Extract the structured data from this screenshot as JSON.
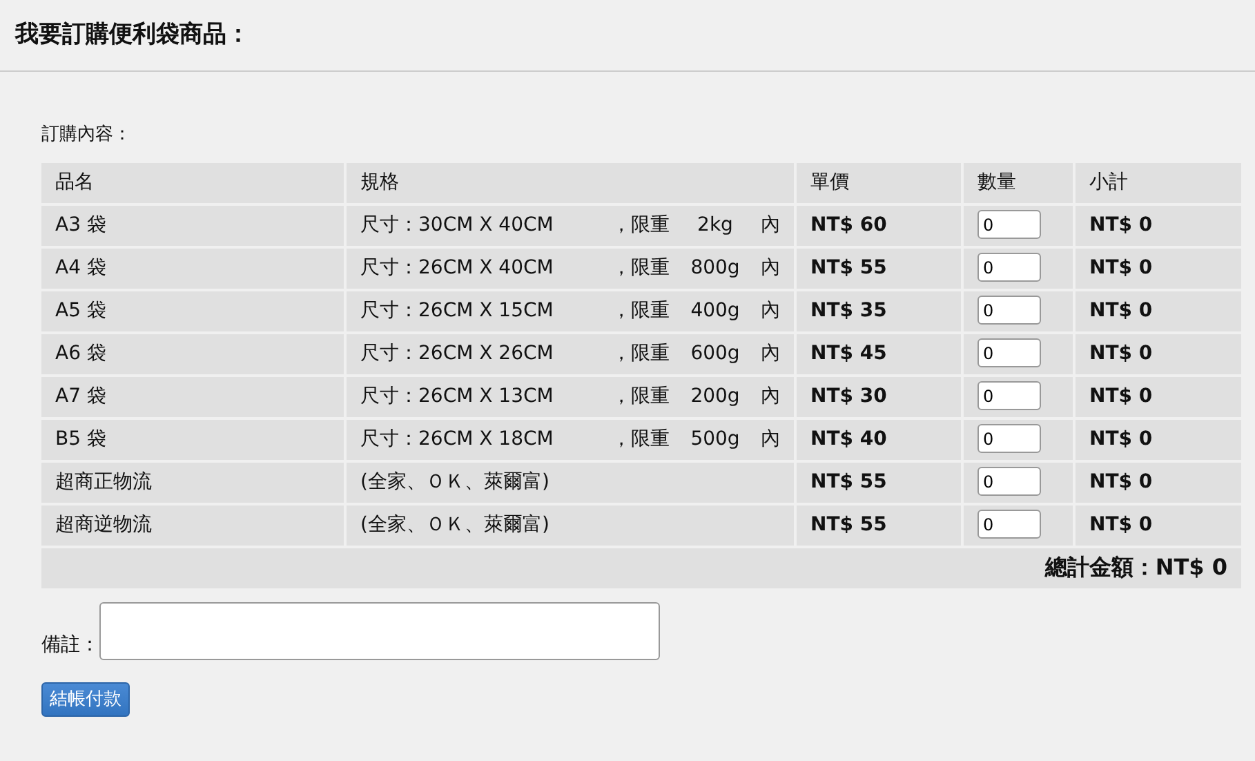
{
  "page_title": "我要訂購便利袋商品：",
  "section_label": "訂購內容：",
  "table": {
    "columns": [
      "品名",
      "規格",
      "單價",
      "數量",
      "小計"
    ],
    "rows": [
      {
        "kind": "bag",
        "name": "A3 袋",
        "size": "尺寸：30CM X 40CM",
        "limit": "，限重",
        "weight": "2kg",
        "suffix": "內",
        "price": "NT$ 60",
        "quantity": "0",
        "subtotal": "NT$ 0"
      },
      {
        "kind": "bag",
        "name": "A4 袋",
        "size": "尺寸：26CM X 40CM",
        "limit": "，限重",
        "weight": "800g",
        "suffix": "內",
        "price": "NT$ 55",
        "quantity": "0",
        "subtotal": "NT$ 0"
      },
      {
        "kind": "bag",
        "name": "A5 袋",
        "size": "尺寸：26CM X 15CM",
        "limit": "，限重",
        "weight": "400g",
        "suffix": "內",
        "price": "NT$ 35",
        "quantity": "0",
        "subtotal": "NT$ 0"
      },
      {
        "kind": "bag",
        "name": "A6 袋",
        "size": "尺寸：26CM X 26CM",
        "limit": "，限重",
        "weight": "600g",
        "suffix": "內",
        "price": "NT$ 45",
        "quantity": "0",
        "subtotal": "NT$ 0"
      },
      {
        "kind": "bag",
        "name": "A7 袋",
        "size": "尺寸：26CM X 13CM",
        "limit": "，限重",
        "weight": "200g",
        "suffix": "內",
        "price": "NT$ 30",
        "quantity": "0",
        "subtotal": "NT$ 0"
      },
      {
        "kind": "bag",
        "name": "B5 袋",
        "size": "尺寸：26CM X 18CM",
        "limit": "，限重",
        "weight": "500g",
        "suffix": "內",
        "price": "NT$ 40",
        "quantity": "0",
        "subtotal": "NT$ 0"
      },
      {
        "kind": "shipping",
        "name": "超商正物流",
        "note": "(全家、ＯＫ、萊爾富)",
        "price": "NT$ 55",
        "quantity": "0",
        "subtotal": "NT$ 0"
      },
      {
        "kind": "shipping",
        "name": "超商逆物流",
        "note": "(全家、ＯＫ、萊爾富)",
        "price": "NT$ 55",
        "quantity": "0",
        "subtotal": "NT$ 0"
      }
    ],
    "total": "總計金額：NT$ 0"
  },
  "remarks": {
    "label": "備註："
  },
  "checkout_button": "結帳付款"
}
